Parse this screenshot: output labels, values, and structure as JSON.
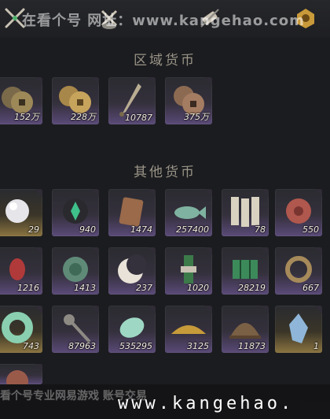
{
  "watermark_top": "在看个号  网址：www.kangehao.com",
  "watermark_bottom": "看个号专业网易游戏 账号交易",
  "watermark_url": "www.kangehao.",
  "sections": [
    {
      "title": "区域货币"
    },
    {
      "title": "其他货币"
    }
  ],
  "regional_items": [
    {
      "icon": "copper-coins-icon",
      "qty": "152万",
      "frame": "purple"
    },
    {
      "icon": "gold-coins-icon",
      "qty": "228万",
      "frame": "purple"
    },
    {
      "icon": "dagger-token-icon",
      "qty": "10787",
      "frame": "purple"
    },
    {
      "icon": "bronze-coins-icon",
      "qty": "375万",
      "frame": "purple"
    }
  ],
  "other_items": [
    {
      "icon": "pearl-icon",
      "qty": "29",
      "frame": "gold"
    },
    {
      "icon": "green-gem-icon",
      "qty": "940",
      "frame": "purple"
    },
    {
      "icon": "copper-plate-icon",
      "qty": "1474",
      "frame": "purple"
    },
    {
      "icon": "jade-fish-icon",
      "qty": "257400",
      "frame": "purple"
    },
    {
      "icon": "paper-tickets-icon",
      "qty": "78",
      "frame": "purple"
    },
    {
      "icon": "red-orb-icon",
      "qty": "550",
      "frame": "purple"
    },
    {
      "icon": "red-lantern-icon",
      "qty": "1216",
      "frame": "purple"
    },
    {
      "icon": "jade-disc-icon",
      "qty": "1413",
      "frame": "purple"
    },
    {
      "icon": "crescent-moon-icon",
      "qty": "237",
      "frame": "purple"
    },
    {
      "icon": "green-charm-icon",
      "qty": "1020",
      "frame": "purple"
    },
    {
      "icon": "green-map-icon",
      "qty": "28219",
      "frame": "purple"
    },
    {
      "icon": "coiled-rope-icon",
      "qty": "667",
      "frame": "purple"
    },
    {
      "icon": "jade-ring-icon",
      "qty": "743",
      "frame": "gold"
    },
    {
      "icon": "coin-sword-icon",
      "qty": "87963",
      "frame": "purple"
    },
    {
      "icon": "jade-stone-icon",
      "qty": "535295",
      "frame": "purple"
    },
    {
      "icon": "gold-feather-icon",
      "qty": "3125",
      "frame": "purple"
    },
    {
      "icon": "bronze-dome-icon",
      "qty": "11873",
      "frame": "purple"
    },
    {
      "icon": "crystal-shard-icon",
      "qty": "1",
      "frame": "gold"
    }
  ],
  "colors": {
    "background": "#1b1c1f",
    "slot_purple": "#5a4a78",
    "slot_gold": "#8a7440",
    "section_title": "#9a9488"
  }
}
